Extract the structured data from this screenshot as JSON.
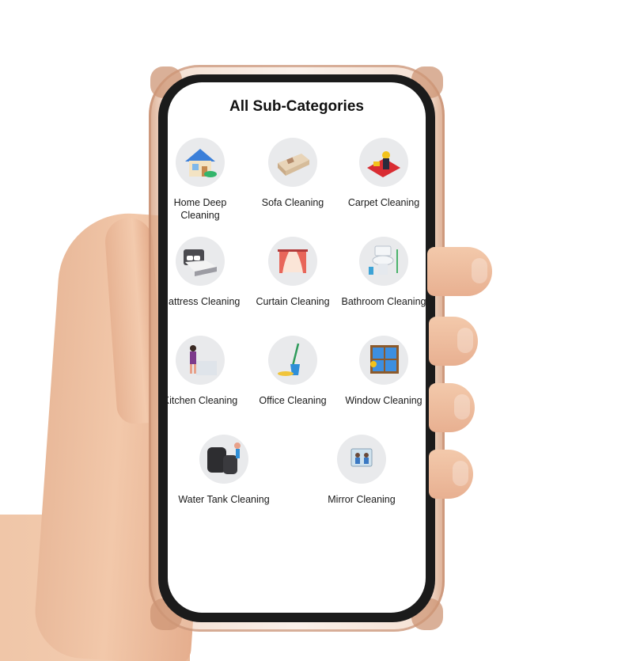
{
  "screen": {
    "title": "All Sub-Categories"
  },
  "categories": [
    {
      "label": "Home Deep Cleaning",
      "icon": "house-icon"
    },
    {
      "label": "Sofa Cleaning",
      "icon": "sofa-icon"
    },
    {
      "label": "Carpet Cleaning",
      "icon": "carpet-icon"
    },
    {
      "label": "Mattress Cleaning",
      "icon": "bed-icon"
    },
    {
      "label": "Curtain Cleaning",
      "icon": "curtain-icon"
    },
    {
      "label": "Bathroom Cleaning",
      "icon": "toilet-icon"
    },
    {
      "label": "Kitchen Cleaning",
      "icon": "kitchen-icon"
    },
    {
      "label": "Office Cleaning",
      "icon": "mop-bucket-icon"
    },
    {
      "label": "Window Cleaning",
      "icon": "window-icon"
    },
    {
      "label": "Water Tank Cleaning",
      "icon": "water-tank-icon"
    },
    {
      "label": "Mirror Cleaning",
      "icon": "mirror-icon"
    }
  ],
  "colors": {
    "icon_background": "#e9eaec",
    "screen_background": "#ffffff",
    "title_text": "#111111"
  }
}
